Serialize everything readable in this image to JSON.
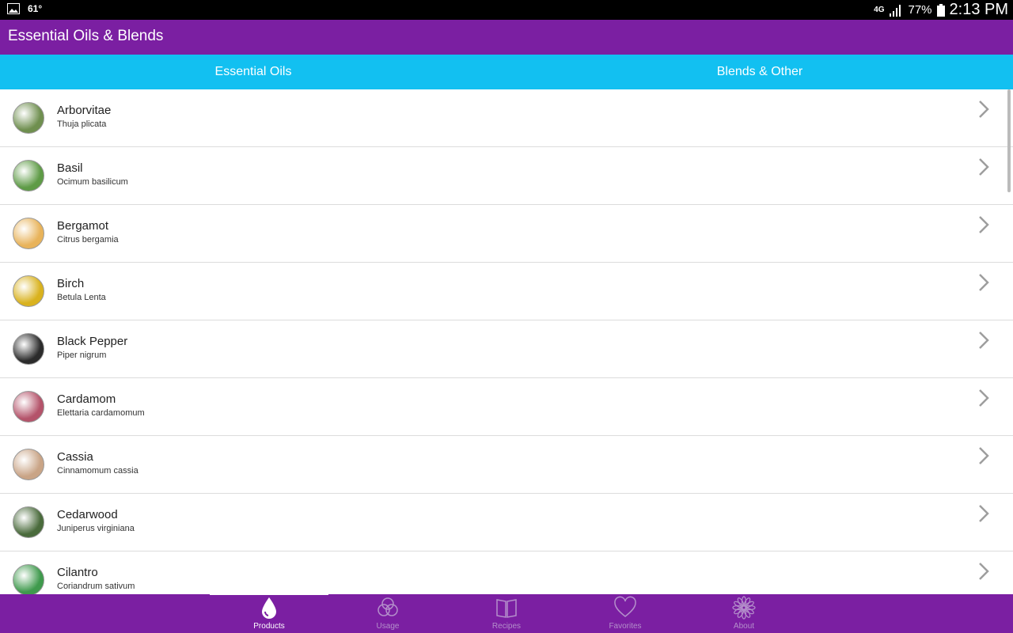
{
  "status": {
    "temperature": "61°",
    "network": "4G",
    "battery": "77%",
    "time": "2:13 PM"
  },
  "app": {
    "title": "Essential Oils & Blends"
  },
  "tabs": [
    {
      "label": "Essential Oils"
    },
    {
      "label": "Blends & Other"
    }
  ],
  "oils": [
    {
      "name": "Arborvitae",
      "latin": "Thuja plicata",
      "color": "#6f8f4f"
    },
    {
      "name": "Basil",
      "latin": "Ocimum basilicum",
      "color": "#5e9b46"
    },
    {
      "name": "Bergamot",
      "latin": "Citrus bergamia",
      "color": "#e8b35a"
    },
    {
      "name": "Birch",
      "latin": "Betula Lenta",
      "color": "#d9b21e"
    },
    {
      "name": "Black Pepper",
      "latin": "Piper nigrum",
      "color": "#2b2b2b"
    },
    {
      "name": "Cardamom",
      "latin": "Elettaria cardamomum",
      "color": "#b4536a"
    },
    {
      "name": "Cassia",
      "latin": "Cinnamomum cassia",
      "color": "#c9a486"
    },
    {
      "name": "Cedarwood",
      "latin": "Juniperus virginiana",
      "color": "#4a6b3c"
    },
    {
      "name": "Cilantro",
      "latin": "Coriandrum sativum",
      "color": "#3f9a4d"
    }
  ],
  "nav": [
    {
      "label": "Products",
      "icon": "drop-icon"
    },
    {
      "label": "Usage",
      "icon": "usage-circles-icon"
    },
    {
      "label": "Recipes",
      "icon": "book-icon"
    },
    {
      "label": "Favorites",
      "icon": "heart-icon"
    },
    {
      "label": "About",
      "icon": "flower-icon"
    }
  ],
  "colors": {
    "primary": "#7b1fa2",
    "tabs": "#12c0f1"
  }
}
